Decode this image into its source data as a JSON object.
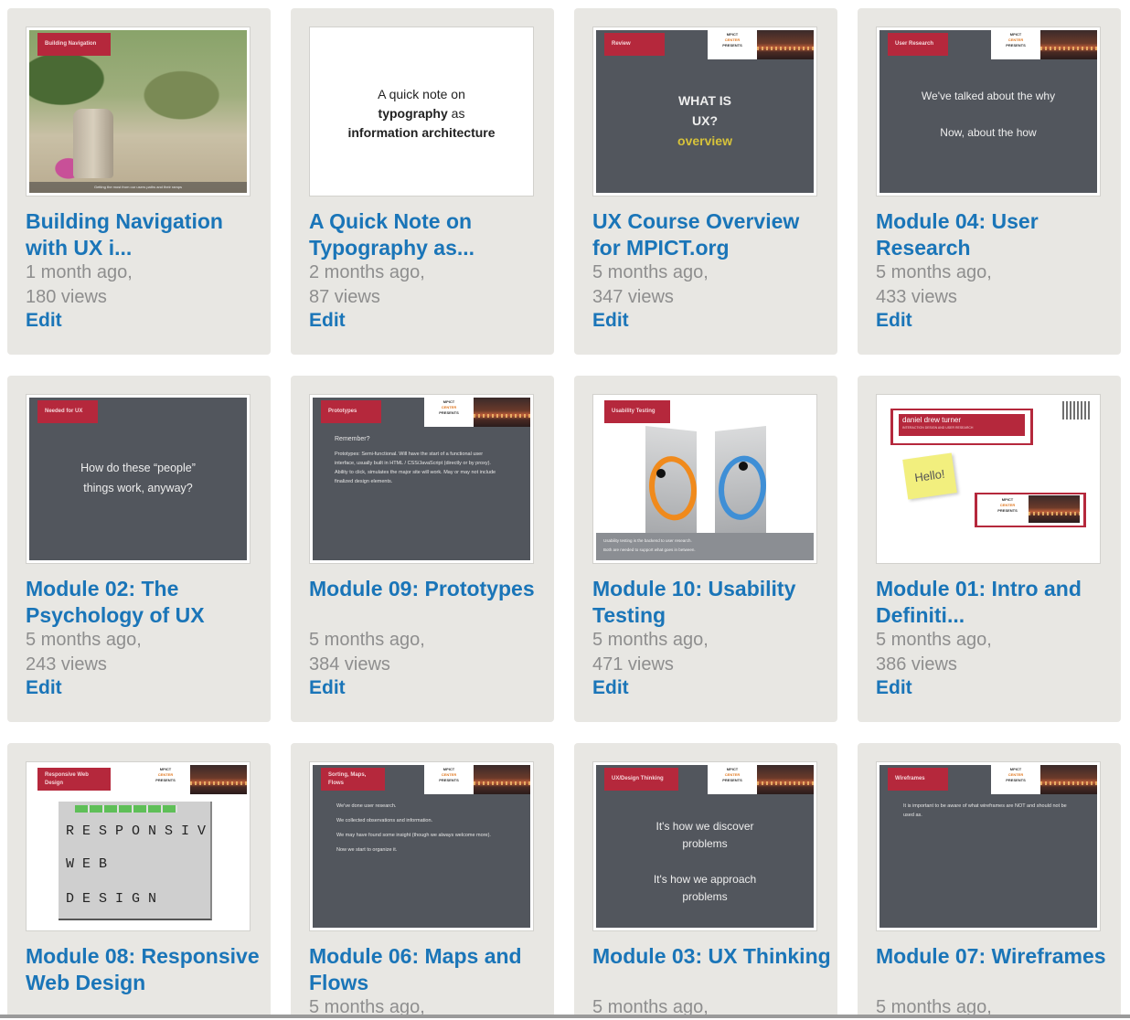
{
  "cards": [
    {
      "title": "Building Navigation with UX i...",
      "meta_time": "1 month ago,",
      "meta_views": "180 views",
      "edit": "Edit",
      "slide": {
        "tag": "Building Navigation",
        "caption": "Getting the most from our users paths and their ramps"
      }
    },
    {
      "title": "A Quick Note on Typography as...",
      "meta_time": "2 months ago,",
      "meta_views": "87 views",
      "edit": "Edit",
      "slide": {
        "line1": "A quick note on",
        "line2": "typography",
        "line2b": " as",
        "line3": "information architecture"
      }
    },
    {
      "title": "UX Course Overview for MPICT.org",
      "meta_time": "5 months ago,",
      "meta_views": "347 views",
      "edit": "Edit",
      "slide": {
        "tag": "Review",
        "line1": "WHAT IS",
        "line2": "UX?",
        "line3": "overview"
      }
    },
    {
      "title": "Module 04: User Research",
      "meta_time": "5 months ago,",
      "meta_views": "433 views",
      "edit": "Edit",
      "slide": {
        "tag": "User Research",
        "line1": "We've talked about the why",
        "line2": "Now, about the how"
      }
    },
    {
      "title": "Module 02: The Psychology of UX",
      "meta_time": "5 months ago,",
      "meta_views": "243 views",
      "edit": "Edit",
      "slide": {
        "tag": "Needed for UX",
        "line1": "How do these “people”",
        "line2": "things work, anyway?"
      }
    },
    {
      "title": "Module 09: Prototypes",
      "meta_time": "5 months ago,",
      "meta_views": "384 views",
      "edit": "Edit",
      "slide": {
        "tag": "Prototypes",
        "heading": "Remember?",
        "body": "Prototypes: Semi-functional. Will have the start of a functional user interface, usually built in HTML / CSS/JavaScript (directly or by proxy). Ability to click, simulates the major site will work. May or may not include finalized design elements."
      }
    },
    {
      "title": "Module 10: Usability Testing",
      "meta_time": "5 months ago,",
      "meta_views": "471 views",
      "edit": "Edit",
      "slide": {
        "tag": "Usability Testing",
        "bar1": "Usability testing is the backend to user research.",
        "bar2": "Both are needed to support what goes in between."
      }
    },
    {
      "title": "Module 01: Intro and Definiti...",
      "meta_time": "5 months ago,",
      "meta_views": "386 views",
      "edit": "Edit",
      "slide": {
        "name": "daniel drew turner",
        "sub": "INTERACTION DESIGN AND USER RESEARCH",
        "postit": "Hello!"
      }
    },
    {
      "title": "Module 08: Responsive Web Design",
      "meta_time": "",
      "meta_views": "",
      "edit": "",
      "slide": {
        "tag": "Responsive Web Design",
        "line1": "RESPONSIV",
        "line2": "WEB",
        "line3": "DESIGN"
      }
    },
    {
      "title": "Module 06: Maps and Flows",
      "meta_time": "5 months ago,",
      "meta_views": "",
      "edit": "",
      "slide": {
        "tag": "Sorting, Maps, Flows",
        "lines": [
          "We've done user research.",
          "We collected observations and information.",
          "We may have found some insight (though we always welcome more).",
          "Now we start to organize it."
        ]
      }
    },
    {
      "title": "Module 03: UX Thinking",
      "meta_time": "5 months ago,",
      "meta_views": "",
      "edit": "",
      "slide": {
        "tag": "UX/Design Thinking",
        "line1": "It's how we discover",
        "line2": "problems",
        "line3": "It's how we approach",
        "line4": "problems"
      }
    },
    {
      "title": "Module 07: Wireframes",
      "meta_time": "5 months ago,",
      "meta_views": "",
      "edit": "",
      "slide": {
        "tag": "Wireframes",
        "body": "It is important to be aware of what wireframes are NOT and should not be used as."
      }
    }
  ],
  "brand": {
    "logo_line1": "MPICT",
    "logo_line2": "CENTER",
    "logo_line3": "PRESENTS"
  }
}
